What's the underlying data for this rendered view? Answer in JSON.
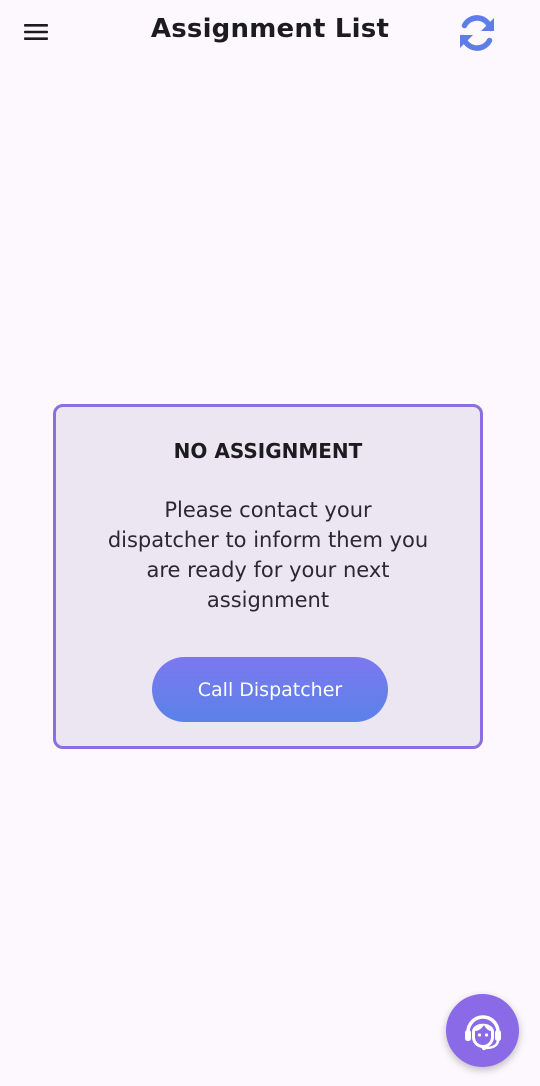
{
  "app_bar": {
    "title": "Assignment List",
    "menu_icon": "hamburger-menu-icon",
    "refresh_icon": "refresh-icon",
    "accent_color": "#5f7de8"
  },
  "empty_state": {
    "title": "NO ASSIGNMENT",
    "message": "Please contact your dispatcher to inform them you are ready for your next assignment",
    "button_label": "Call Dispatcher",
    "border_color": "#8c6ee0",
    "background_color": "#ece6f3"
  },
  "fab": {
    "icon": "support-agent-icon",
    "color": "#8a6ae6"
  }
}
